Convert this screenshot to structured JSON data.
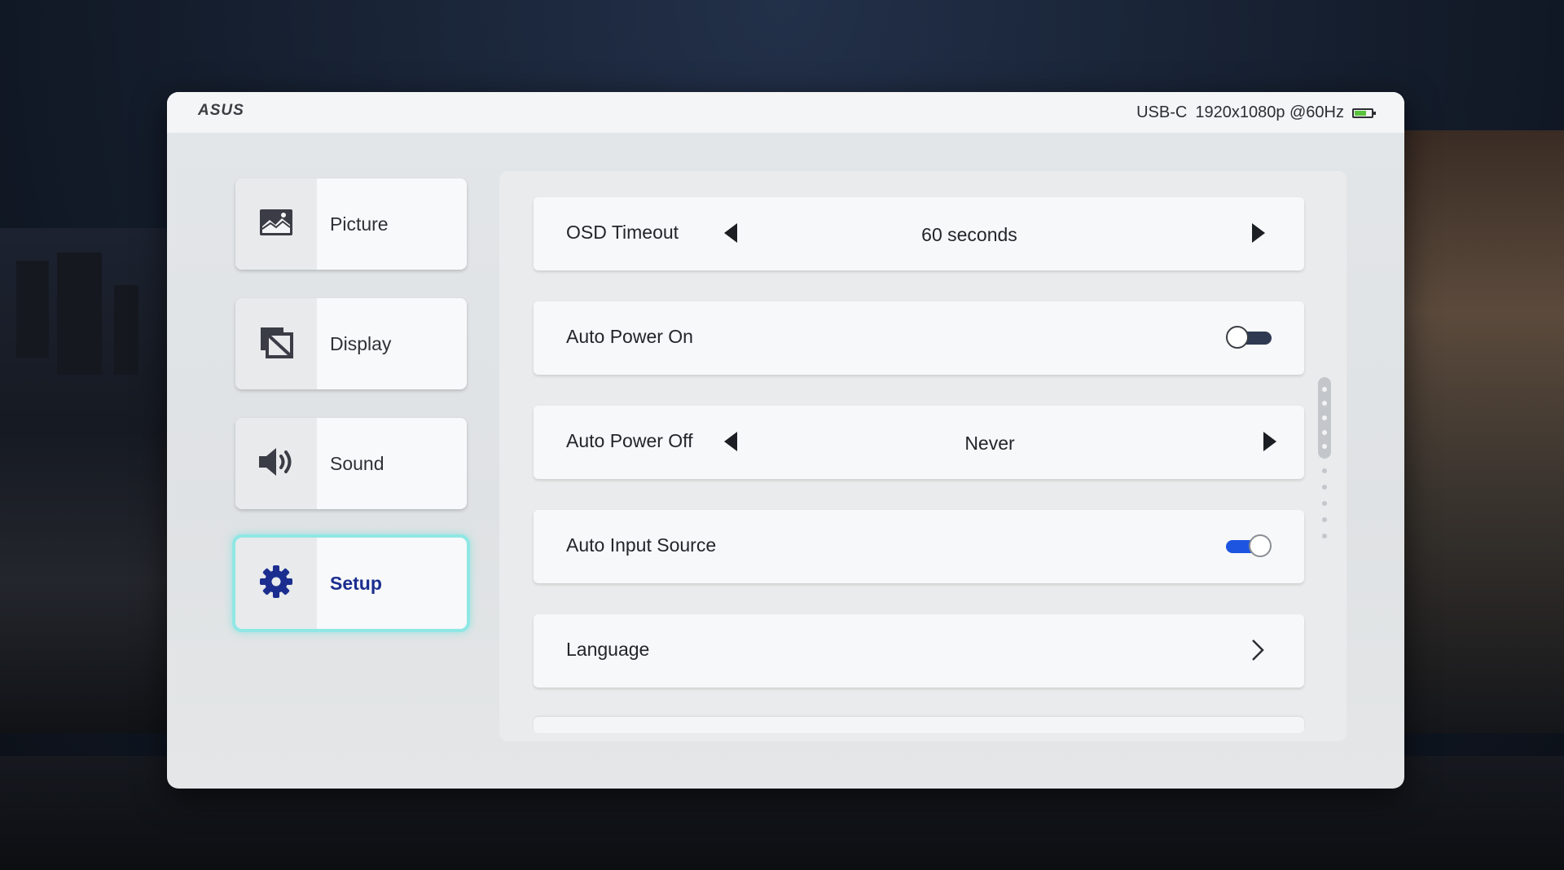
{
  "header": {
    "brand": "ASUS",
    "input_source": "USB-C",
    "resolution": "1920x1080p @60Hz",
    "battery_icon": "battery-icon"
  },
  "sidebar": {
    "items": [
      {
        "label": "Picture",
        "icon": "picture-icon",
        "active": false
      },
      {
        "label": "Display",
        "icon": "display-icon",
        "active": false
      },
      {
        "label": "Sound",
        "icon": "speaker-icon",
        "active": false
      },
      {
        "label": "Setup",
        "icon": "gear-icon",
        "active": true
      }
    ]
  },
  "settings": {
    "osd_timeout": {
      "label": "OSD Timeout",
      "value": "60 seconds"
    },
    "auto_power_on": {
      "label": "Auto Power On",
      "enabled": false
    },
    "auto_power_off": {
      "label": "Auto Power Off",
      "value": "Never"
    },
    "auto_input_source": {
      "label": "Auto Input Source",
      "enabled": true
    },
    "language": {
      "label": "Language"
    }
  },
  "colors": {
    "accent_highlight": "#8fe7e4",
    "active_text": "#1b2e8f",
    "toggle_on": "#1d55e0",
    "battery_fill": "#58c33b"
  }
}
